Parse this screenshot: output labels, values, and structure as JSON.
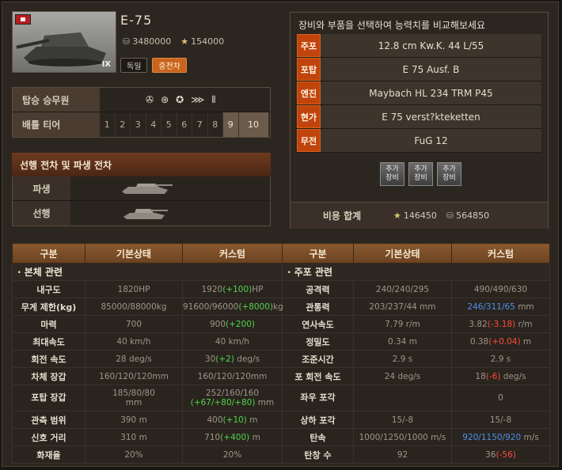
{
  "tank": {
    "name": "E-75",
    "credits": "3480000",
    "xp": "154000",
    "tier_roman": "IX",
    "nation": "독일",
    "class": "중전차"
  },
  "crew_row": {
    "label": "탑승 승무원",
    "icons": [
      "✇",
      "⊛",
      "✪",
      "⋙",
      "⦀"
    ]
  },
  "tier_row": {
    "label": "배틀 티어",
    "tiers": [
      "1",
      "2",
      "3",
      "4",
      "5",
      "6",
      "7",
      "8",
      "9",
      "10"
    ]
  },
  "tree": {
    "title": "선행 전차 및 파생 전차",
    "successor_label": "파생",
    "predecessor_label": "선행"
  },
  "equipment": {
    "title": "장비와 부품을 선택하여 능력치를 비교해보세요",
    "rows": [
      {
        "key": "주포",
        "value": "12.8 cm Kw.K. 44 L/55"
      },
      {
        "key": "포탑",
        "value": "E 75 Ausf. B"
      },
      {
        "key": "엔진",
        "value": "Maybach HL 234 TRM P45"
      },
      {
        "key": "현가",
        "value": "E 75 verst?kteketten"
      },
      {
        "key": "무전",
        "value": "FuG 12"
      }
    ],
    "add_buttons": [
      "추가\n장비",
      "추가\n장비",
      "추가\n장비"
    ],
    "total_label": "비용 합계",
    "total_xp": "146450",
    "total_credits": "564850"
  },
  "stats": {
    "headers": [
      "구분",
      "기본상태",
      "커스텀",
      "구분",
      "기본상태",
      "커스텀"
    ],
    "left_section": "본체 관련",
    "right_section": "주포 관련",
    "rows": [
      {
        "l_label": "내구도",
        "l_base": "1820HP",
        "l_custom": "1920(+100)HP",
        "r_label": "공격력",
        "r_base": "240/240/295",
        "r_custom": "490/490/630"
      },
      {
        "l_label": "무게 제한(kg)",
        "l_base": "85000/88000kg",
        "l_custom": "91600/96000(+8000)kg",
        "r_label": "관통력",
        "r_base": "203/237/44 mm",
        "r_custom": "246/311/65 mm"
      },
      {
        "l_label": "마력",
        "l_base": "700",
        "l_custom": "900(+200)",
        "r_label": "연사속도",
        "r_base": "7.79 r/m",
        "r_custom": "3.82(-3.18) r/m"
      },
      {
        "l_label": "최대속도",
        "l_base": "40 km/h",
        "l_custom": "40 km/h",
        "r_label": "정밀도",
        "r_base": "0.34 m",
        "r_custom": "0.38(+0.04) m"
      },
      {
        "l_label": "회전 속도",
        "l_base": "28 deg/s",
        "l_custom": "30(+2) deg/s",
        "r_label": "조준시간",
        "r_base": "2.9 s",
        "r_custom": "2.9 s"
      },
      {
        "l_label": "차체 장갑",
        "l_base": "160/120/120mm",
        "l_custom": "160/120/120mm",
        "r_label": "포 회전 속도",
        "r_base": "24 deg/s",
        "r_custom": "18(-6) deg/s"
      },
      {
        "l_label": "포탑 장갑",
        "l_base": "185/80/80 mm",
        "l_custom": "252/160/160 (+67/+80/+80) mm",
        "r_label": "좌우 포각",
        "r_base": "",
        "r_custom": "0"
      },
      {
        "l_label": "관측 범위",
        "l_base": "390 m",
        "l_custom": "400(+10) m",
        "r_label": "상하 포각",
        "r_base": "15/-8",
        "r_custom": "15/-8"
      },
      {
        "l_label": "신호 거리",
        "l_base": "310 m",
        "l_custom": "710(+400) m",
        "r_label": "탄속",
        "r_base": "1000/1250/1000 m/s",
        "r_custom": "920/1150/920 m/s"
      },
      {
        "l_label": "화재율",
        "l_base": "20%",
        "l_custom": "20%",
        "r_label": "탄창 수",
        "r_base": "92",
        "r_custom": "36(-56)"
      }
    ]
  },
  "colors": {
    "accent": "#c0440c",
    "header": "#8a5a30",
    "green": "#4fd44a",
    "red": "#ff4a3a",
    "blue": "#4a8fe8"
  }
}
